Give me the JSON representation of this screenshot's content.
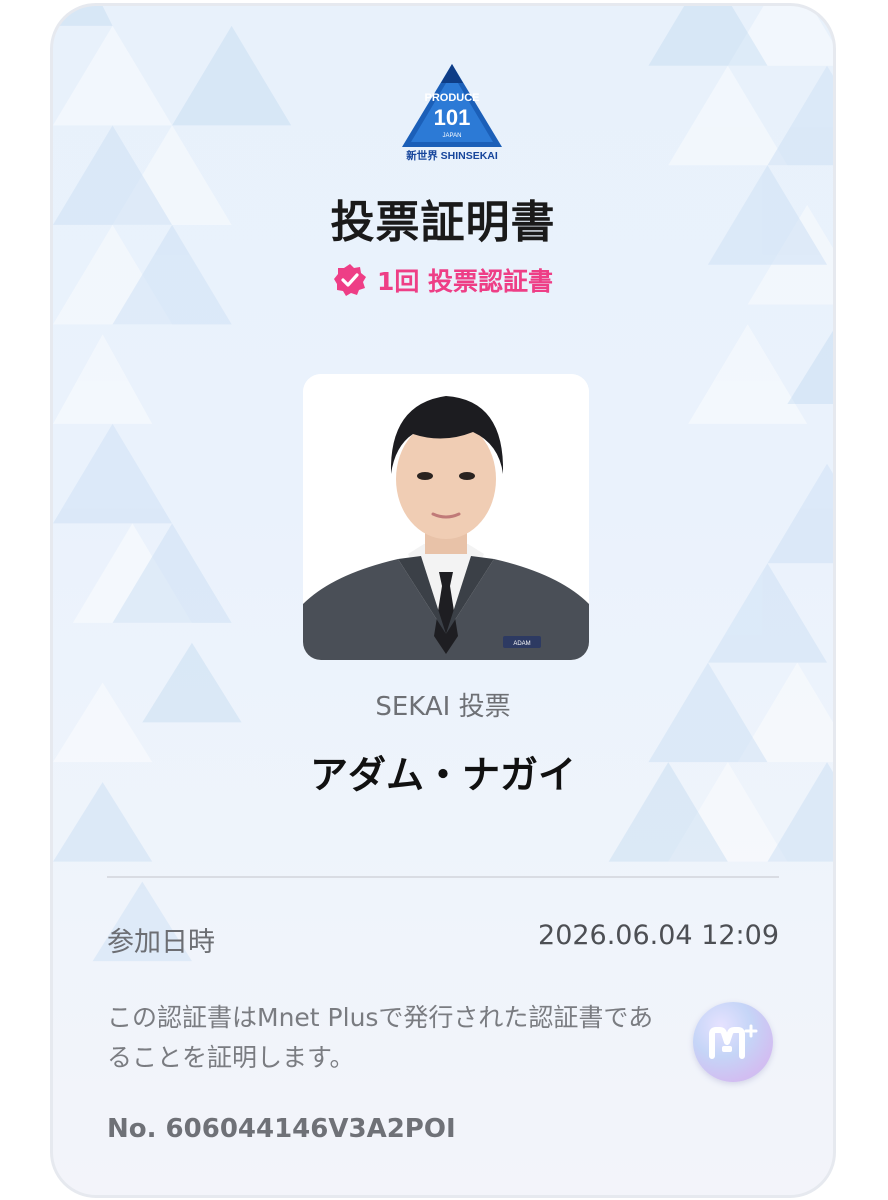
{
  "logo": {
    "line1": "PRODUCE",
    "line2": "101",
    "line3": "JAPAN",
    "line4": "新世界 SHINSEKAI"
  },
  "certificate": {
    "title": "投票証明書",
    "badge_text": "1回 投票認証書",
    "badge_icon": "verified-check-icon",
    "vote_type": "SEKAI 投票",
    "trainee_name": "アダム・ナガイ",
    "date_label": "参加日時",
    "date_value": "2026.06.04 12:09",
    "description": "この認証書はMnet Plusで発行された認証書であることを証明します。",
    "serial": "No. 606044146V3A2POI",
    "name_tag": "ADAM"
  },
  "colors": {
    "accent_pink": "#ee3e86",
    "logo_blue": "#1b5fb8",
    "background": "#e8f1fb"
  }
}
